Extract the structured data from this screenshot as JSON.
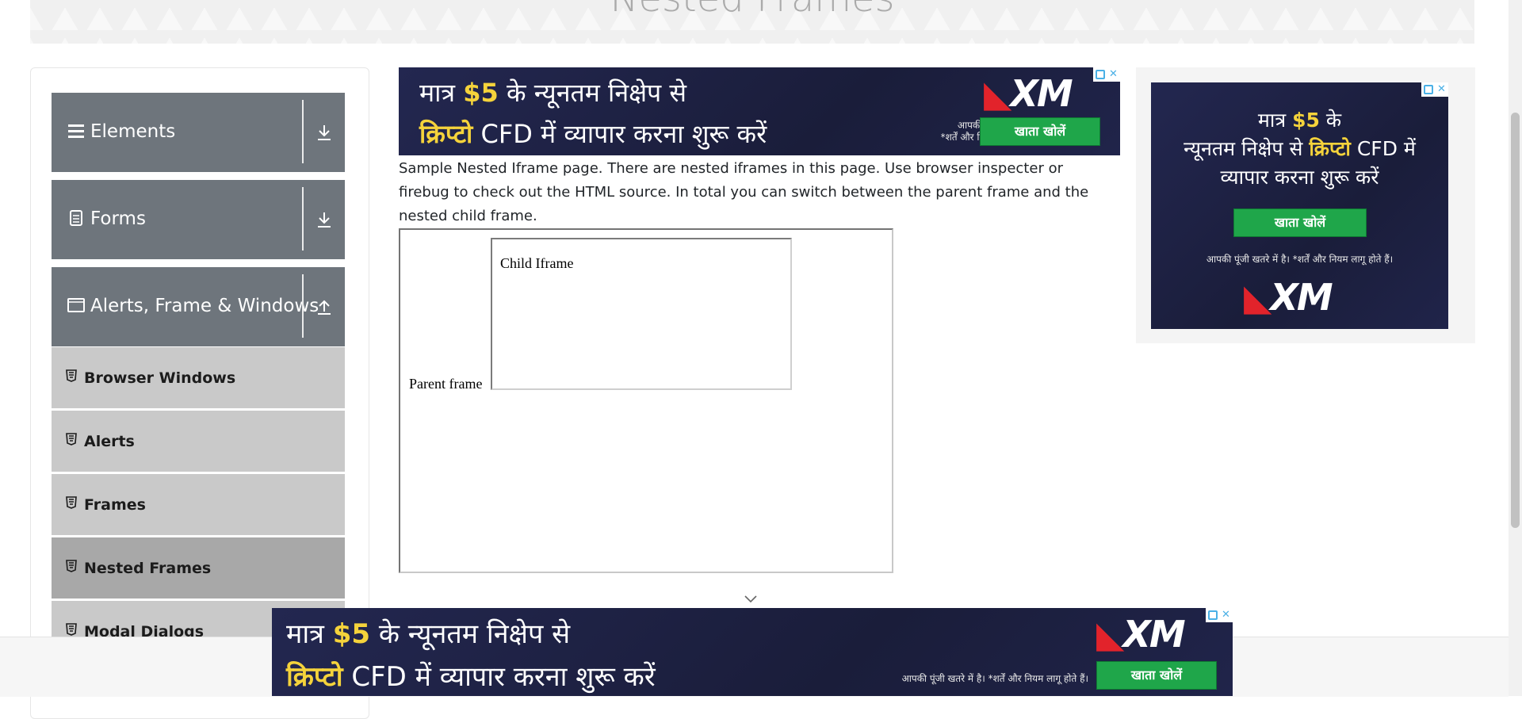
{
  "page": {
    "title": "Nested Frames"
  },
  "sidebar": {
    "groups": [
      {
        "label": "Elements",
        "icon": "hamburger-icon",
        "action_icon": "download-arrow-icon"
      },
      {
        "label": "Forms",
        "icon": "document-icon",
        "action_icon": "download-arrow-icon"
      },
      {
        "label": "Alerts, Frame & Windows",
        "icon": "window-icon",
        "action_icon": "upload-arrow-icon"
      }
    ],
    "items": [
      {
        "label": "Browser Windows",
        "active": false
      },
      {
        "label": "Alerts",
        "active": false
      },
      {
        "label": "Frames",
        "active": false
      },
      {
        "label": "Nested Frames",
        "active": true
      },
      {
        "label": "Modal Dialogs",
        "active": false
      }
    ]
  },
  "content": {
    "description": "Sample Nested Iframe page. There are nested iframes in this page. Use browser inspecter or firebug to check out the HTML source. In total you can switch between the parent frame and the nested child frame.",
    "parent_frame_label": "Parent frame",
    "child_frame_label": "Child Iframe"
  },
  "ads": {
    "top": {
      "line1_pre": "मात्र ",
      "line1_amount": "$5",
      "line1_post": " के न्यूनतम निक्षेप से",
      "line2_hl": "क्रिप्टो",
      "line2_post": " CFD में  व्यापार करना शुरू करें",
      "disclaimer1": "आपकी पूंजी खतरे में है।",
      "disclaimer2": "*शर्तें और नियम लागू होते हैं।",
      "button": "खाता खोलें",
      "logo": "XM"
    },
    "side": {
      "line1_pre": "मात्र ",
      "line1_amount": "$5",
      "line1_post": " के",
      "line2_pre": "न्यूनतम निक्षेप से ",
      "line2_hl": "क्रिप्टो",
      "line2_post": " CFD में",
      "line3": "व्यापार करना शुरू करें",
      "button": "खाता खोलें",
      "disclaimer": "आपकी पूंजी खतरे में है। *शर्तें और नियम लागू होते हैं।",
      "logo": "XM"
    },
    "bottom": {
      "line1_pre": "मात्र ",
      "line1_amount": "$5",
      "line1_post": " के न्यूनतम निक्षेप से",
      "line2_hl": "क्रिप्टो",
      "line2_post": " CFD में  व्यापार करना शुरू करें",
      "disclaimer": "आपकी पूंजी खतरे में है। *शर्तें और नियम लागू होते हैं।",
      "button": "खाता खोलें",
      "logo": "XM"
    }
  },
  "colors": {
    "sidebar_header": "#6e757c",
    "menu_item": "#c9c9c9",
    "menu_item_active": "#a8a8a8",
    "ad_background": "#1b1e3d",
    "ad_highlight": "#f5d33b",
    "ad_button": "#1fa64a",
    "logo_mark": "#e2232b"
  }
}
